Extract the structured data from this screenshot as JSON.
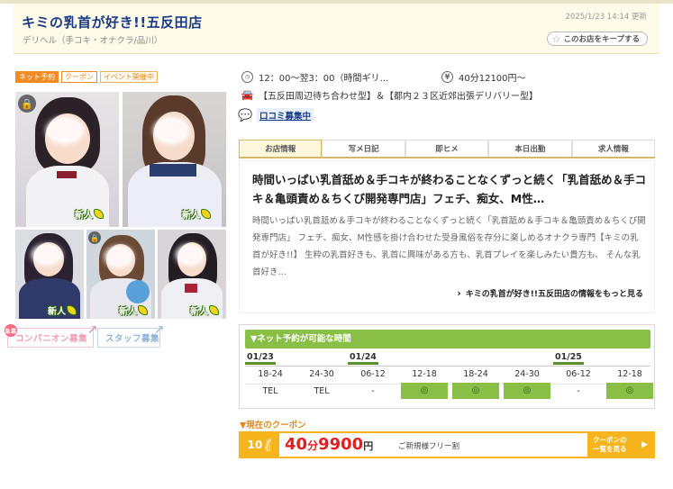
{
  "header": {
    "shop_name": "キミの乳首が好き!!五反田店",
    "category": "デリヘル（手コキ・オナクラ/品川）",
    "updated": "2025/1/23 14:14 更新",
    "keep_label": "このお店をキープする"
  },
  "tags": [
    "ネット予約",
    "クーポン",
    "イベント開催中"
  ],
  "photos": {
    "new_label": "新人"
  },
  "recruit": {
    "companion": "コンパニオン募集",
    "staff": "スタッフ募集",
    "mark": "急募"
  },
  "info": {
    "hours": "12：00〜翌3：00（時間ギリ…",
    "price": "40分12100円〜",
    "area": "【五反田周辺待ち合わせ型】＆【都内２３区近郊出張デリバリー型】",
    "review_link": "口コミ募集中"
  },
  "tabs": [
    "お店情報",
    "写メ日記",
    "即ヒメ",
    "本日出勤",
    "求人情報"
  ],
  "shop_info": {
    "catch": "時間いっぱい乳首舐め＆手コキが終わることなくずっと続く「乳首舐め＆手コキ＆亀頭責め＆ちくび開発専門店」フェチ、痴女、M性…",
    "description": "時間いっぱい乳首舐め＆手コキが終わることなくずっと続く「乳首舐め＆手コキ＆亀頭責め＆ちくび開発専門店」 フェチ、痴女、M性感を掛け合わせた受身風俗を存分に楽しめるオナクラ専門【キミの乳首が好き!!】 生粋の乳首好きも、乳首に興味がある方も、乳首プレイを楽しみたい貴方も、 そんな乳首好き…",
    "more_link": "キミの乳首が好き!!五反田店の情報をもっと見る"
  },
  "reservation": {
    "title": "▼ネット予約が可能な時間",
    "dates": [
      "01/23",
      "01/24",
      "01/25"
    ],
    "slots": [
      {
        "time": "18-24",
        "value": "TEL"
      },
      {
        "time": "24-30",
        "value": "TEL"
      },
      {
        "time": "06-12",
        "value": "-"
      },
      {
        "time": "12-18",
        "value": "◎"
      },
      {
        "time": "18-24",
        "value": "◎"
      },
      {
        "time": "24-30",
        "value": "◎"
      },
      {
        "time": "06-12",
        "value": "-"
      },
      {
        "time": "12-18",
        "value": "◎"
      }
    ]
  },
  "coupon": {
    "title": "▼現在のクーポン",
    "percent": "10",
    "percent_unit": "%引",
    "minutes": "40",
    "minutes_unit": "分",
    "price": "9900",
    "yen": "円",
    "note": "ご新規様フリー割",
    "button_line1": "クーポンの",
    "button_line2": "一覧を見る"
  }
}
